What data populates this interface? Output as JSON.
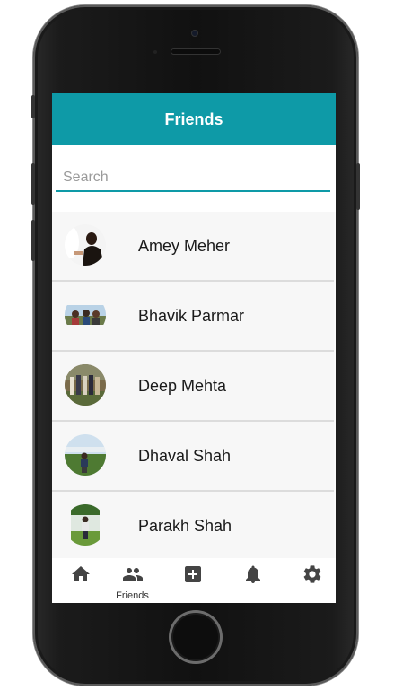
{
  "header": {
    "title": "Friends"
  },
  "search": {
    "placeholder": "Search",
    "value": ""
  },
  "friends": [
    {
      "name": "Amey Meher"
    },
    {
      "name": "Bhavik Parmar"
    },
    {
      "name": "Deep Mehta"
    },
    {
      "name": "Dhaval Shah"
    },
    {
      "name": "Parakh Shah"
    }
  ],
  "tabs": [
    {
      "icon": "home-icon",
      "label": ""
    },
    {
      "icon": "people-icon",
      "label": "Friends",
      "active": true
    },
    {
      "icon": "add-box-icon",
      "label": ""
    },
    {
      "icon": "bell-icon",
      "label": ""
    },
    {
      "icon": "gear-icon",
      "label": ""
    }
  ],
  "colors": {
    "accent": "#0e9aa7",
    "tab_icon": "#444444",
    "row_bg": "#f7f7f7"
  }
}
